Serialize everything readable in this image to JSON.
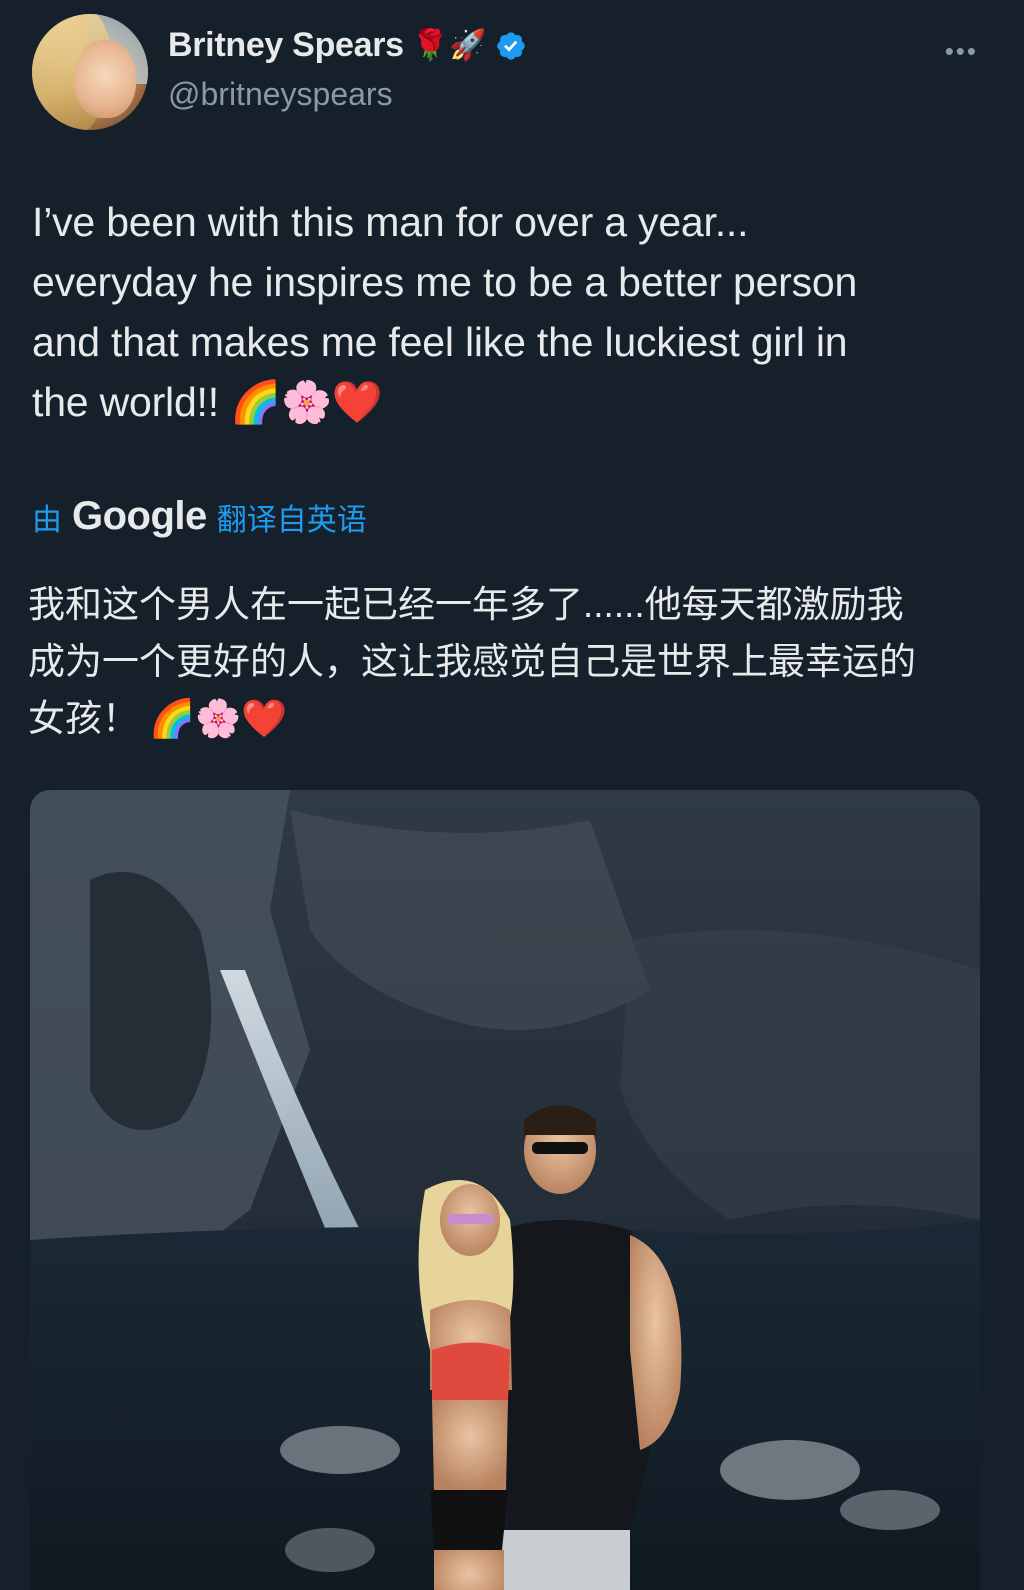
{
  "author": {
    "display_name": "Britney Spears",
    "name_emojis": "🌹🚀",
    "handle": "@britneyspears",
    "verified": true
  },
  "more_menu_label": "•••",
  "tweet": {
    "lines": [
      "I’ve been with this man for over a year...",
      "everyday he inspires me to be a better person",
      "and that makes me feel like the luckiest girl in",
      "the world!! 🌈🌸❤️"
    ]
  },
  "translation": {
    "by_label": "由",
    "provider": "Google",
    "translated_from_label": "翻译自英语",
    "lines": [
      "我和这个男人在一起已经一年多了......他每天都激励我",
      "成为一个更好的人，这让我感觉自己是世界上最幸运的",
      "女孩！ 🌈🌸❤️"
    ]
  },
  "colors": {
    "background": "#15202b",
    "text": "#e7e9ea",
    "secondary_text": "#8b98a5",
    "accent": "#1d9bf0"
  },
  "icons": {
    "verified": "verified-badge-icon",
    "more": "more-horizontal-icon"
  }
}
